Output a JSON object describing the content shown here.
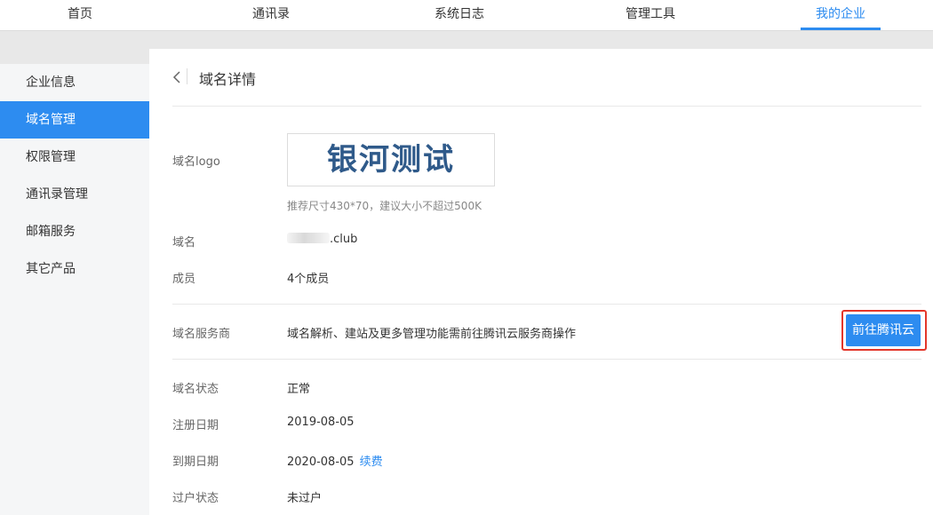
{
  "topnav": {
    "items": [
      "首页",
      "通讯录",
      "系统日志",
      "管理工具",
      "我的企业"
    ],
    "active": "我的企业"
  },
  "sidebar": {
    "items": [
      "企业信息",
      "域名管理",
      "权限管理",
      "通讯录管理",
      "邮箱服务",
      "其它产品"
    ],
    "active": "域名管理"
  },
  "page": {
    "title": "域名详情"
  },
  "details": {
    "logo_label": "域名logo",
    "logo_text": "银河测试",
    "logo_hint": "推荐尺寸430*70，建议大小不超过500K",
    "domain_label": "域名",
    "domain_suffix": ".club",
    "members_label": "成员",
    "members_value": "4个成员",
    "provider_label": "域名服务商",
    "provider_value": "域名解析、建站及更多管理功能需前往腾讯云服务商操作",
    "goto_button": "前往腾讯云",
    "status_label": "域名状态",
    "status_value": "正常",
    "register_label": "注册日期",
    "register_value": "2019-08-05",
    "expire_label": "到期日期",
    "expire_value": "2020-08-05",
    "renew_link": "续费",
    "transfer_label": "过户状态",
    "transfer_value": "未过户"
  },
  "colors": {
    "accent": "#2d8cf0",
    "highlight_border": "#e3362a",
    "logo_text": "#2f5a8a"
  },
  "icons": {
    "back": "chevron-left-icon"
  }
}
